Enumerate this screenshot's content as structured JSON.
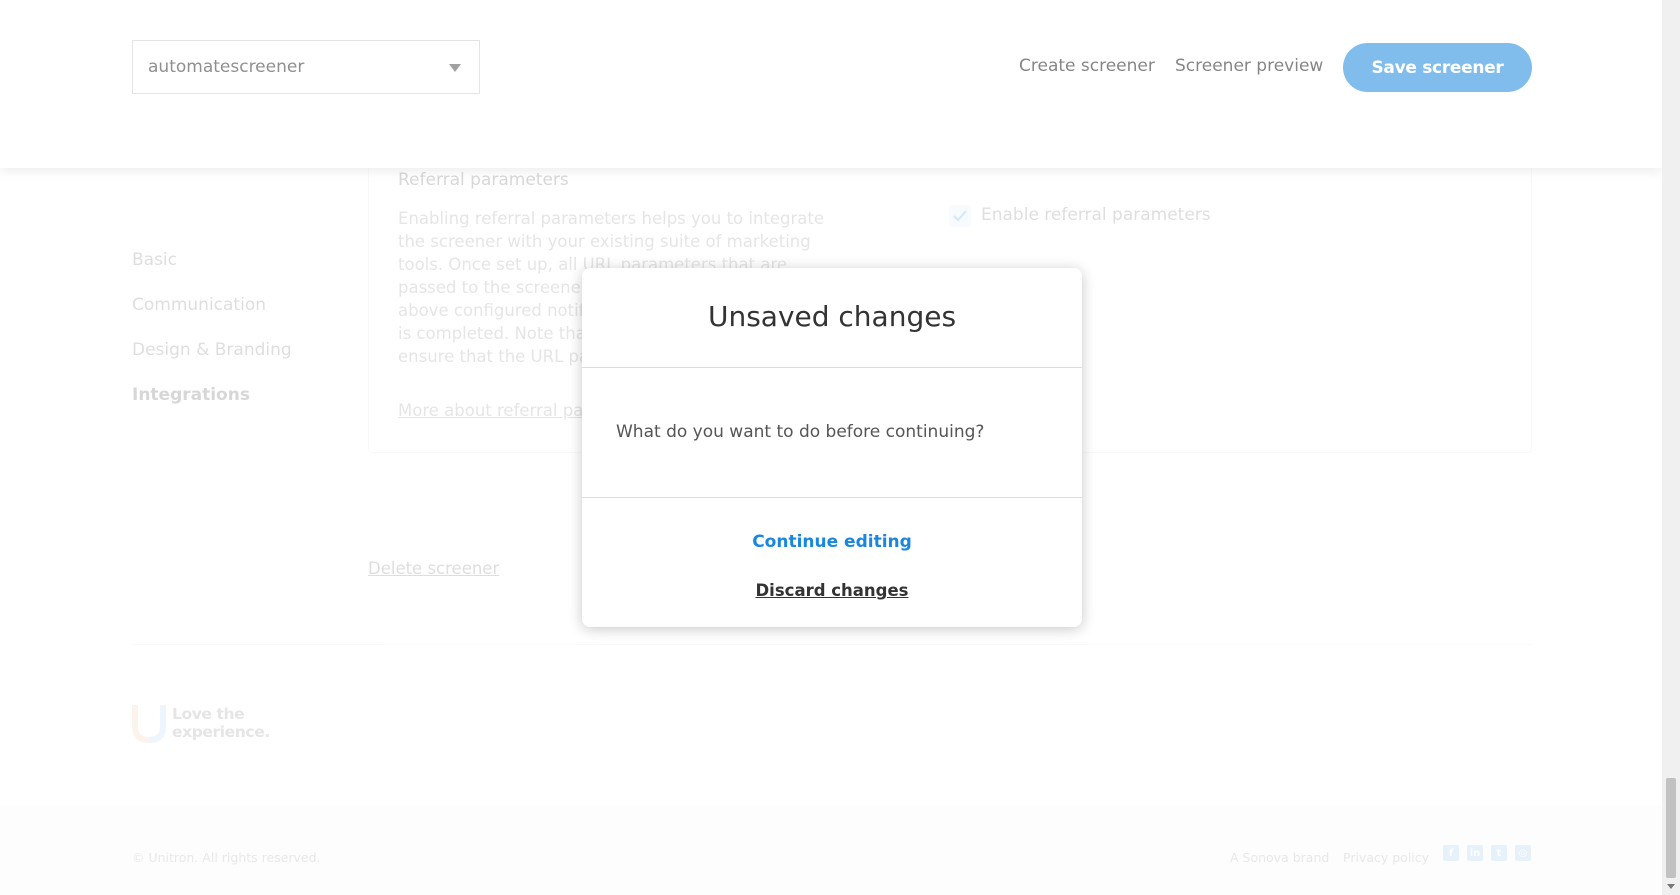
{
  "header": {
    "screener_select": {
      "value": "automatescreener"
    },
    "create_label": "Create screener",
    "preview_label": "Screener preview",
    "save_label": "Save screener"
  },
  "sidebar": {
    "items": [
      {
        "label": "Basic"
      },
      {
        "label": "Communication"
      },
      {
        "label": "Design & Branding"
      },
      {
        "label": "Integrations"
      }
    ]
  },
  "card": {
    "title": "Referral parameters",
    "description": "Enabling referral parameters helps you to integrate the screener with your existing suite of marketing tools. Once set up, all URL parameters that are passed to the screener are returned through the above configured notifications, in case the screener is completed. Note that it is your responsibility to ensure that the URL parameters with",
    "link": "More about referral parameters",
    "checkbox_label": "Enable referral parameters",
    "checkbox_checked": true
  },
  "delete_label": "Delete screener",
  "logo": {
    "line1": "Love the",
    "line2": "experience."
  },
  "footer": {
    "copyright": "© Unitron. All rights reserved.",
    "brand": "A Sonova brand",
    "privacy": "Privacy policy",
    "social": [
      "facebook-icon",
      "linkedin-icon",
      "twitter-icon",
      "instagram-icon"
    ]
  },
  "modal": {
    "title": "Unsaved changes",
    "body": "What do you want to do before continuing?",
    "continue_label": "Continue editing",
    "discard_label": "Discard changes"
  },
  "colors": {
    "accent": "#1a87dc"
  }
}
